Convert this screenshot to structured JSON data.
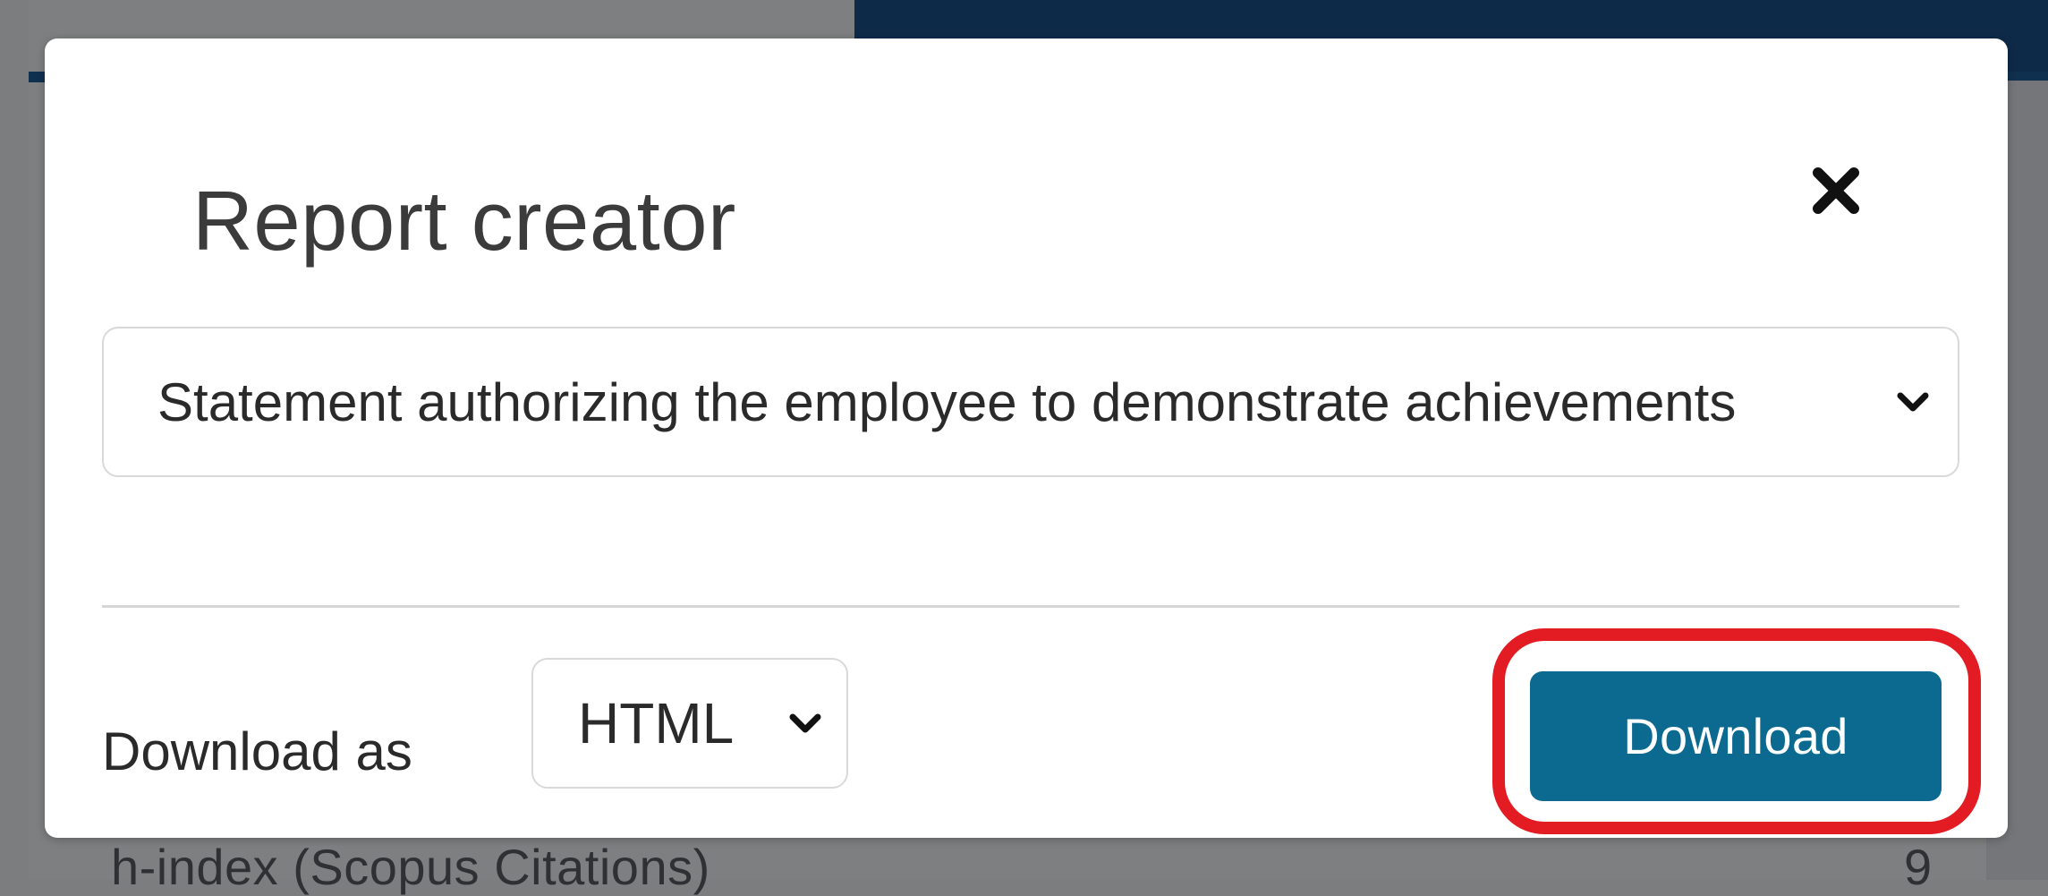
{
  "modal": {
    "title": "Report creator",
    "close_icon": "close-icon",
    "report_select": {
      "selected": "Statement authorizing the employee to demonstrate achievements",
      "icon": "chevron-down-icon"
    },
    "download_as_label": "Download as",
    "format_select": {
      "selected": "HTML",
      "icon": "chevron-down-icon"
    },
    "download_button_label": "Download"
  },
  "background": {
    "row_label": "h-index (Scopus Citations)",
    "row_value": "9"
  },
  "colors": {
    "header_navy": "#0e2a49",
    "button_blue": "#0c6a91",
    "highlight_red": "#e31b23",
    "overlay_gray": "#7e7f81"
  }
}
